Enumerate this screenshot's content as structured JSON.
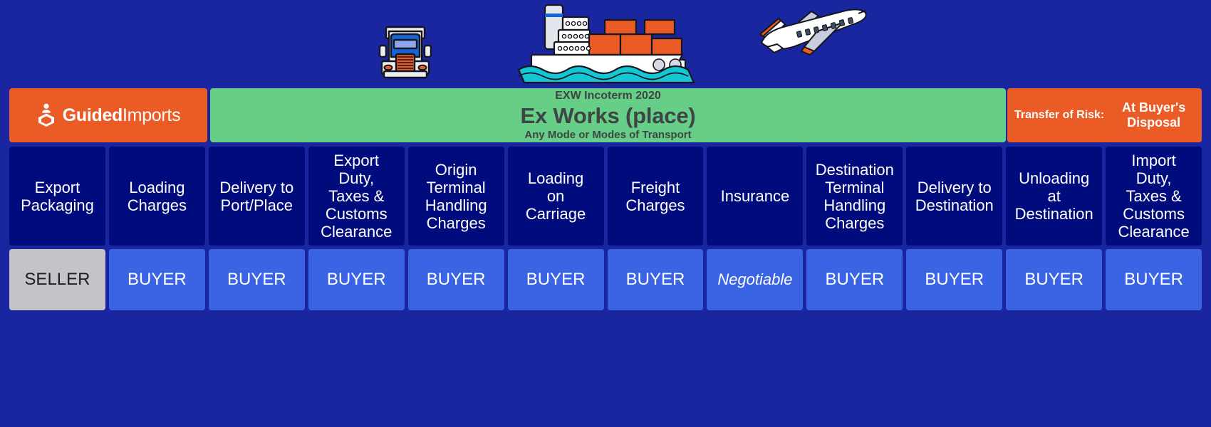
{
  "brand": {
    "logo_icon": "guided-imports-hexagon-logo",
    "name_bold": "Guided",
    "name_light": "Imports"
  },
  "header": {
    "eyebrow": "EXW Incoterm 2020",
    "title": "Ex Works (place)",
    "subtitle": "Any Mode or Modes of Transport",
    "risk_label": "Transfer of Risk:",
    "risk_value": "At Buyer's Disposal"
  },
  "transport_icons": [
    {
      "name": "truck-illustration"
    },
    {
      "name": "container-ship-illustration"
    },
    {
      "name": "airplane-illustration"
    }
  ],
  "colors": {
    "background": "#1a25a0",
    "brand_orange": "#ea5b25",
    "incoterm_green": "#66ce86",
    "header_cell": "#000b7d",
    "buyer_blue": "#3b64e4",
    "seller_grey": "#c4c4c8",
    "title_text": "#3f4444"
  },
  "columns": [
    {
      "header": "Export\nPackaging",
      "party": "SELLER",
      "party_type": "seller"
    },
    {
      "header": "Loading\nCharges",
      "party": "BUYER",
      "party_type": "buyer"
    },
    {
      "header": "Delivery to\nPort/Place",
      "party": "BUYER",
      "party_type": "buyer"
    },
    {
      "header": "Export\nDuty,\nTaxes &\nCustoms\nClearance",
      "party": "BUYER",
      "party_type": "buyer"
    },
    {
      "header": "Origin\nTerminal\nHandling\nCharges",
      "party": "BUYER",
      "party_type": "buyer"
    },
    {
      "header": "Loading\non\nCarriage",
      "party": "BUYER",
      "party_type": "buyer"
    },
    {
      "header": "Freight\nCharges",
      "party": "BUYER",
      "party_type": "buyer"
    },
    {
      "header": "Insurance",
      "party": "Negotiable",
      "party_type": "negotiable"
    },
    {
      "header": "Destination\nTerminal\nHandling\nCharges",
      "party": "BUYER",
      "party_type": "buyer"
    },
    {
      "header": "Delivery to\nDestination",
      "party": "BUYER",
      "party_type": "buyer"
    },
    {
      "header": "Unloading\nat\nDestination",
      "party": "BUYER",
      "party_type": "buyer"
    },
    {
      "header": "Import\nDuty,\nTaxes &\nCustoms\nClearance",
      "party": "BUYER",
      "party_type": "buyer"
    }
  ]
}
